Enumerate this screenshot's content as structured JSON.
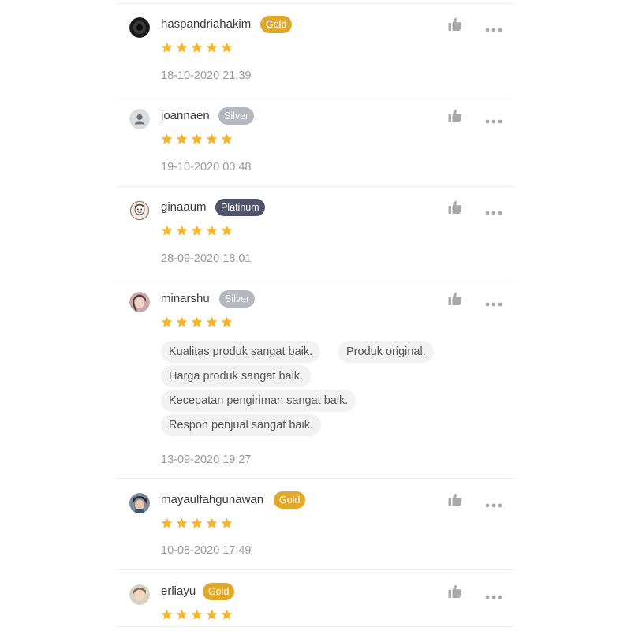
{
  "colors": {
    "gold_badge": "#e0a92b",
    "silver_badge": "#b4b9bf",
    "platinum_badge": "#50546b",
    "star": "#f7b52c",
    "icon_gray": "#a9a9a9"
  },
  "reviews": [
    {
      "username": "haspandriahakim",
      "badge": "Gold",
      "badge_type": "gold",
      "rating": 5,
      "date": "18-10-2020 21:39",
      "avatar": "dark-avatar",
      "tags": []
    },
    {
      "username": "joannaen",
      "badge": "Silver",
      "badge_type": "silver",
      "rating": 5,
      "date": "19-10-2020 00:48",
      "avatar": "default-user-icon",
      "tags": []
    },
    {
      "username": "ginaaum",
      "badge": "Platinum",
      "badge_type": "platinum",
      "rating": 5,
      "date": "28-09-2020 18:01",
      "avatar": "illustrated-avatar",
      "tags": []
    },
    {
      "username": "minarshu",
      "badge": "Silver",
      "badge_type": "silver",
      "rating": 5,
      "date": "13-09-2020 19:27",
      "avatar": "photo-avatar",
      "tags": [
        "Kualitas produk sangat baik.",
        "Produk original.",
        "Harga produk sangat baik.",
        "Kecepatan pengiriman sangat baik.",
        "Respon penjual sangat baik."
      ]
    },
    {
      "username": "mayaulfahgunawan",
      "badge": "Gold",
      "badge_type": "gold",
      "rating": 5,
      "date": "10-08-2020 17:49",
      "avatar": "photo-avatar",
      "tags": []
    },
    {
      "username": "erliayu",
      "badge": "Gold",
      "badge_type": "gold",
      "rating": 5,
      "date": "",
      "avatar": "photo-avatar",
      "tags": []
    }
  ]
}
